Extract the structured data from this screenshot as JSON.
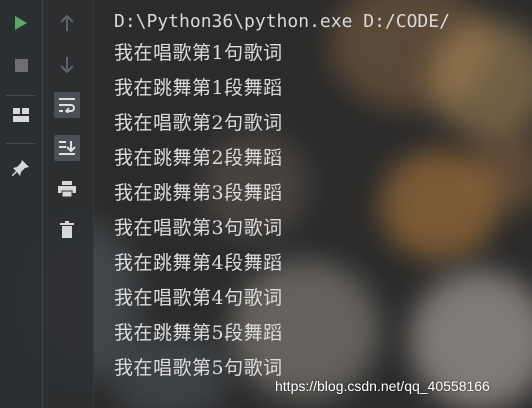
{
  "toolbar_left": {
    "buttons": [
      {
        "icon": "play-icon",
        "color": "#59a869"
      },
      {
        "icon": "stop-icon",
        "color": "#6e6e6e"
      },
      {
        "icon": "layout-icon",
        "color": "#d8d8d8"
      },
      {
        "icon": "pin-icon",
        "color": "#d8d8d8"
      }
    ]
  },
  "toolbar_right": {
    "buttons": [
      {
        "icon": "arrow-up-icon"
      },
      {
        "icon": "arrow-down-icon"
      },
      {
        "icon": "soft-wrap-icon"
      },
      {
        "icon": "scroll-to-end-icon"
      },
      {
        "icon": "print-icon"
      },
      {
        "icon": "trash-icon"
      }
    ]
  },
  "console": {
    "command": "D:\\Python36\\python.exe D:/CODE/",
    "lines": [
      "我在唱歌第1句歌词",
      "我在跳舞第1段舞蹈",
      "我在唱歌第2句歌词",
      "我在跳舞第2段舞蹈",
      "我在跳舞第3段舞蹈",
      "我在唱歌第3句歌词",
      "我在跳舞第4段舞蹈",
      "我在唱歌第4句歌词",
      "我在跳舞第5段舞蹈",
      "我在唱歌第5句歌词"
    ]
  },
  "watermark": "https://blog.csdn.net/qq_40558166",
  "colors": {
    "run_green": "#59a869",
    "text": "#dcdcdc",
    "panel": "#2c2f31"
  }
}
